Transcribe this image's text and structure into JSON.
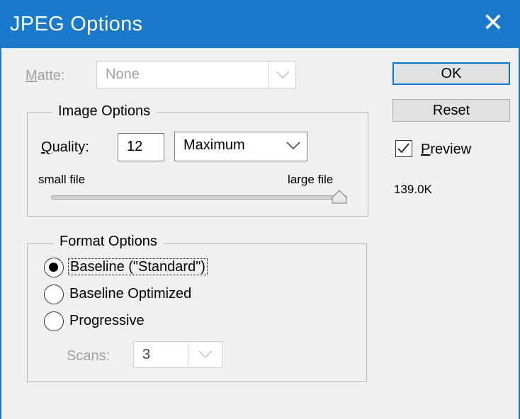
{
  "window": {
    "title": "JPEG Options",
    "close_icon": "close-icon"
  },
  "matte": {
    "label": "Matte:",
    "value": "None"
  },
  "image_options": {
    "legend": "Image Options",
    "quality_label": "Quality:",
    "quality_value": "12",
    "quality_preset": "Maximum",
    "small_file_label": "small file",
    "large_file_label": "large file",
    "slider_fraction": 1.0
  },
  "format_options": {
    "legend": "Format Options",
    "options": [
      {
        "label": "Baseline (\"Standard\")",
        "selected": true
      },
      {
        "label": "Baseline Optimized",
        "selected": false
      },
      {
        "label": "Progressive",
        "selected": false
      }
    ],
    "scans_label": "Scans:",
    "scans_value": "3"
  },
  "buttons": {
    "ok": "OK",
    "reset": "Reset"
  },
  "preview": {
    "label": "Preview",
    "checked": true,
    "file_size": "139.0K"
  },
  "colors": {
    "titlebar": "#1979ca",
    "dialog_bg": "#f0f0f0"
  }
}
